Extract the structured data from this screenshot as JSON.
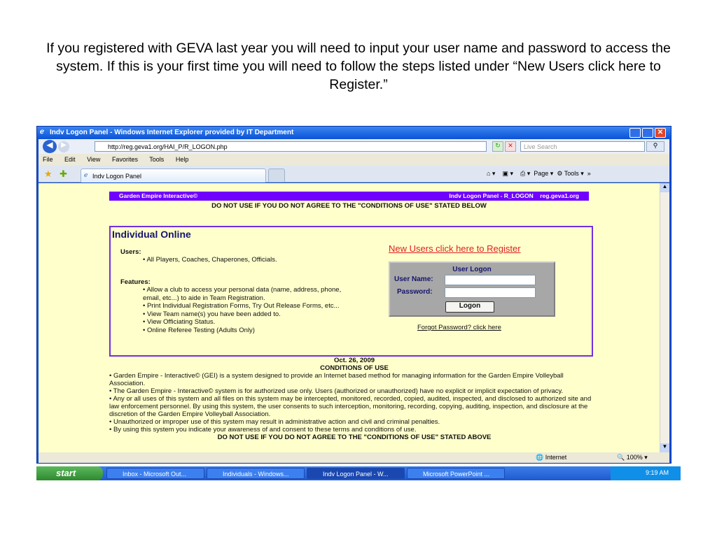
{
  "caption": "If you registered with GEVA last year you will need to input your user name and password to access the system. If this is your first time you will need to follow the steps listed under “New Users click here to Register.”",
  "browser": {
    "title": "Indv Logon Panel - Windows Internet Explorer provided by IT Department",
    "url": "http://reg.geva1.org/HAI_P/R_LOGON.php",
    "search_placeholder": "Live Search",
    "menu": [
      "File",
      "Edit",
      "View",
      "Favorites",
      "Tools",
      "Help"
    ],
    "tab_label": "Indv Logon Panel",
    "page_menu": "Page",
    "tools_menu": "Tools",
    "status_zone": "Internet",
    "zoom": "100%"
  },
  "page": {
    "banner_left": "Garden Empire Interactive©",
    "banner_right": "Indv Logon Panel - R_LOGON    reg.geva1.org",
    "warning_top": "DO NOT USE IF YOU DO NOT AGREE TO THE \"CONDITIONS OF USE\" STATED BELOW",
    "panel_title": "Individual Online",
    "users_heading": "Users:",
    "users": [
      "• All Players, Coaches, Chaperones, Officials."
    ],
    "features_heading": "Features:",
    "features": [
      "• Allow a club to access your personal data (name, address, phone, email, etc...) to aide in Team Registration.",
      "• Print Individual Registration Forms, Try Out Release Forms, etc...",
      "• View Team name(s) you have been added to.",
      "• View Officiating Status.",
      "• Online Referee Testing (Adults Only)"
    ],
    "register_link": "New Users click here to Register",
    "login": {
      "heading": "User Logon",
      "username_label": "User Name:",
      "password_label": "Password:",
      "username_value": "",
      "password_value": "",
      "button": "Logon"
    },
    "forgot_link": "Forgot Password?  click here",
    "date": "Oct. 26, 2009",
    "conditions_title": "CONDITIONS OF USE",
    "conditions": [
      "• Garden Empire - Interactive©  (GEI) is a system designed to provide an Internet based method for managing information for the Garden Empire Volleyball Association.",
      "• The Garden Empire - Interactive©  system is for authorized use only.  Users (authorized or unauthorized) have no explicit or implicit expectation of privacy.",
      "• Any or all uses of this system and all files on this system may be intercepted, monitored, recorded, copied, audited, inspected, and disclosed to authorized site and law enforcement personnel.  By using this system, the user consents to such interception, monitoring, recording, copying, auditing, inspection, and disclosure at the discretion of the Garden Empire Volleyball Association.",
      "• Unauthorized or improper use of this system may result in administrative action and civil and criminal penalties.",
      "• By using this system you indicate your awareness of and consent to these terms and conditions of use."
    ],
    "warning_bottom": "DO NOT USE IF YOU DO NOT AGREE TO THE \"CONDITIONS OF USE\" STATED ABOVE"
  },
  "taskbar": {
    "start": "start",
    "tasks": [
      "Inbox - Microsoft Out...",
      "Individuals - Windows...",
      "Indv Logon Panel - W...",
      "Microsoft PowerPoint ..."
    ],
    "clock": "9:19 AM"
  }
}
